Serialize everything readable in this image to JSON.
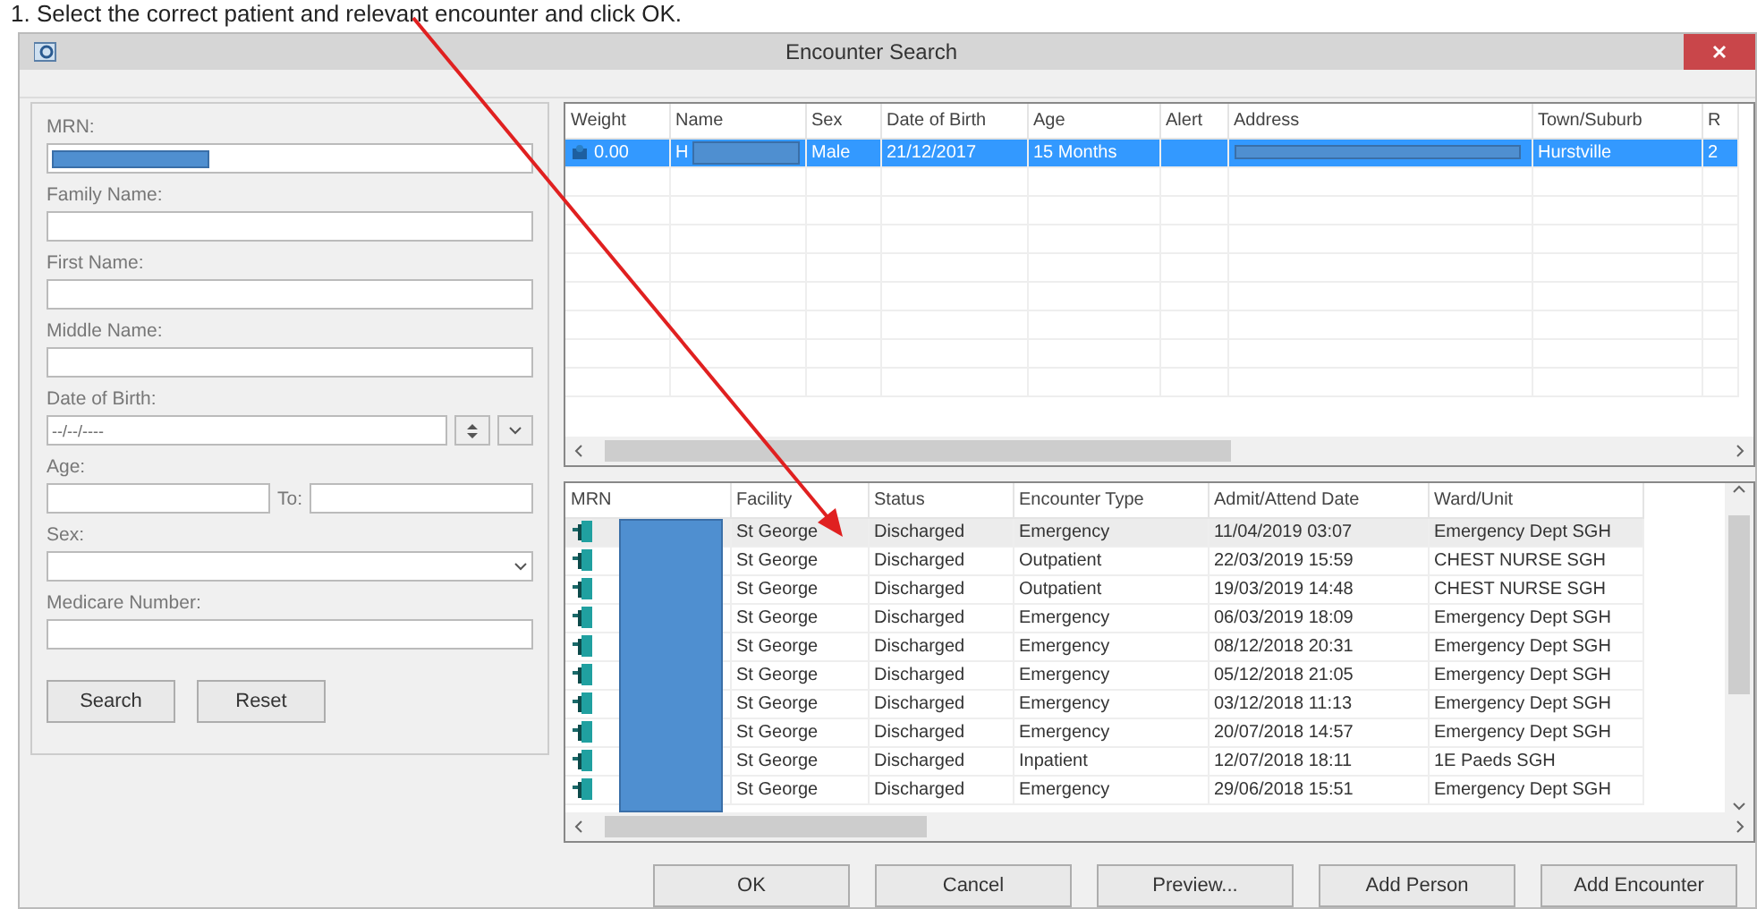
{
  "caption": "1. Select the correct patient and relevant encounter and click OK.",
  "window": {
    "title": "Encounter Search"
  },
  "search_form": {
    "fields": [
      {
        "kind": "text",
        "label": "MRN:",
        "redacted": true
      },
      {
        "kind": "text",
        "label": "Family Name:"
      },
      {
        "kind": "text",
        "label": "First Name:"
      },
      {
        "kind": "text",
        "label": "Middle Name:"
      },
      {
        "kind": "date",
        "label": "Date of Birth:",
        "value": "--/--/----"
      },
      {
        "kind": "range",
        "label": "Age:",
        "to_label": "To:"
      },
      {
        "kind": "select",
        "label": "Sex:"
      },
      {
        "kind": "text",
        "label": "Medicare Number:"
      }
    ],
    "buttons": [
      "Search",
      "Reset"
    ]
  },
  "patients": {
    "columns": [
      "Weight",
      "Name",
      "Sex",
      "Date of Birth",
      "Age",
      "Alert",
      "Address",
      "Town/Suburb",
      "R"
    ],
    "rows": [
      {
        "selected": true,
        "weight": "0.00",
        "name": "H",
        "name_redacted": true,
        "sex": "Male",
        "dob": "21/12/2017",
        "age": "15 Months",
        "alert": "",
        "address_redacted": true,
        "town": "Hurstville",
        "column_9": "2"
      }
    ]
  },
  "encounters": {
    "columns": [
      "MRN",
      "Facility",
      "Status",
      "Encounter Type",
      "Admit/Attend Date",
      "Ward/Unit"
    ],
    "mrn_redacted": true,
    "rows": [
      {
        "selected": true,
        "facility": "St George",
        "status": "Discharged",
        "type": "Emergency",
        "date": "11/04/2019 03:07",
        "ward": "Emergency Dept SGH"
      },
      {
        "selected": false,
        "facility": "St George",
        "status": "Discharged",
        "type": "Outpatient",
        "date": "22/03/2019 15:59",
        "ward": "CHEST NURSE SGH"
      },
      {
        "selected": false,
        "facility": "St George",
        "status": "Discharged",
        "type": "Outpatient",
        "date": "19/03/2019 14:48",
        "ward": "CHEST NURSE SGH"
      },
      {
        "selected": false,
        "facility": "St George",
        "status": "Discharged",
        "type": "Emergency",
        "date": "06/03/2019 18:09",
        "ward": "Emergency Dept SGH"
      },
      {
        "selected": false,
        "facility": "St George",
        "status": "Discharged",
        "type": "Emergency",
        "date": "08/12/2018 20:31",
        "ward": "Emergency Dept SGH"
      },
      {
        "selected": false,
        "facility": "St George",
        "status": "Discharged",
        "type": "Emergency",
        "date": "05/12/2018 21:05",
        "ward": "Emergency Dept SGH"
      },
      {
        "selected": false,
        "facility": "St George",
        "status": "Discharged",
        "type": "Emergency",
        "date": "03/12/2018 11:13",
        "ward": "Emergency Dept SGH"
      },
      {
        "selected": false,
        "facility": "St George",
        "status": "Discharged",
        "type": "Emergency",
        "date": "20/07/2018 14:57",
        "ward": "Emergency Dept SGH"
      },
      {
        "selected": false,
        "facility": "St George",
        "status": "Discharged",
        "type": "Inpatient",
        "date": "12/07/2018 18:11",
        "ward": "1E Paeds SGH"
      },
      {
        "selected": false,
        "facility": "St George",
        "status": "Discharged",
        "type": "Emergency",
        "date": "29/06/2018 15:51",
        "ward": "Emergency Dept SGH"
      }
    ]
  },
  "buttons": [
    "OK",
    "Cancel",
    "Preview...",
    "Add Person",
    "Add Encounter"
  ]
}
